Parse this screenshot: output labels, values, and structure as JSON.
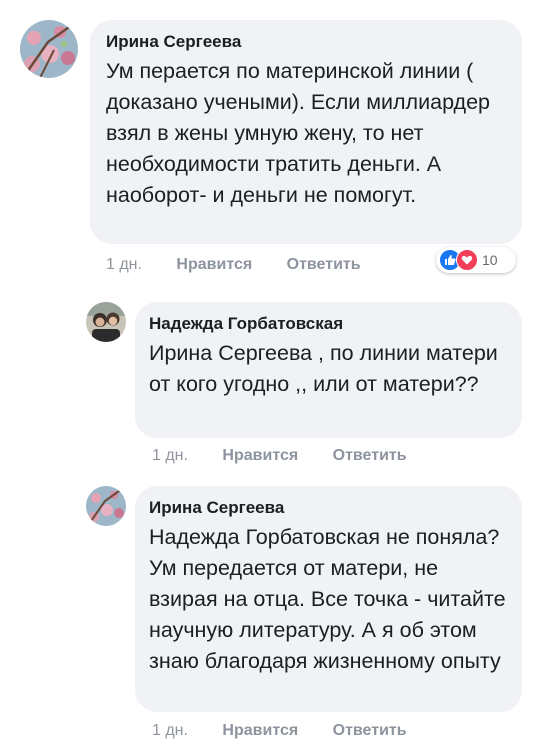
{
  "comments": [
    {
      "author": "Ирина Сергеева",
      "text": "Ум перается по материнской линии ( доказано учеными). Если миллиардер взял в жены умную жену, то нет необходимости тратить деньги. А наоборот- и деньги не помогут.",
      "time": "1 дн.",
      "like_label": "Нравится",
      "reply_label": "Ответить",
      "reaction_count": "10",
      "reactions": [
        "like-icon",
        "love-icon"
      ]
    },
    {
      "author": "Надежда Горбатовская",
      "text": "Ирина Сергеева , по линии матери от кого угодно ,, или от матери??",
      "time": "1 дн.",
      "like_label": "Нравится",
      "reply_label": "Ответить"
    },
    {
      "author": "Ирина Сергеева",
      "text": "Надежда Горбатовская не поняла? Ум передается от матери, не взирая на отца. Все точка - читайте научную литературу. А я об этом знаю благодаря жизненному опыту",
      "time": "1 дн.",
      "like_label": "Нравится",
      "reply_label": "Ответить"
    }
  ],
  "colors": {
    "bubble": "#f0f2f5",
    "meta_text": "#90949c",
    "like": "#1877f2",
    "love": "#f33e58"
  }
}
